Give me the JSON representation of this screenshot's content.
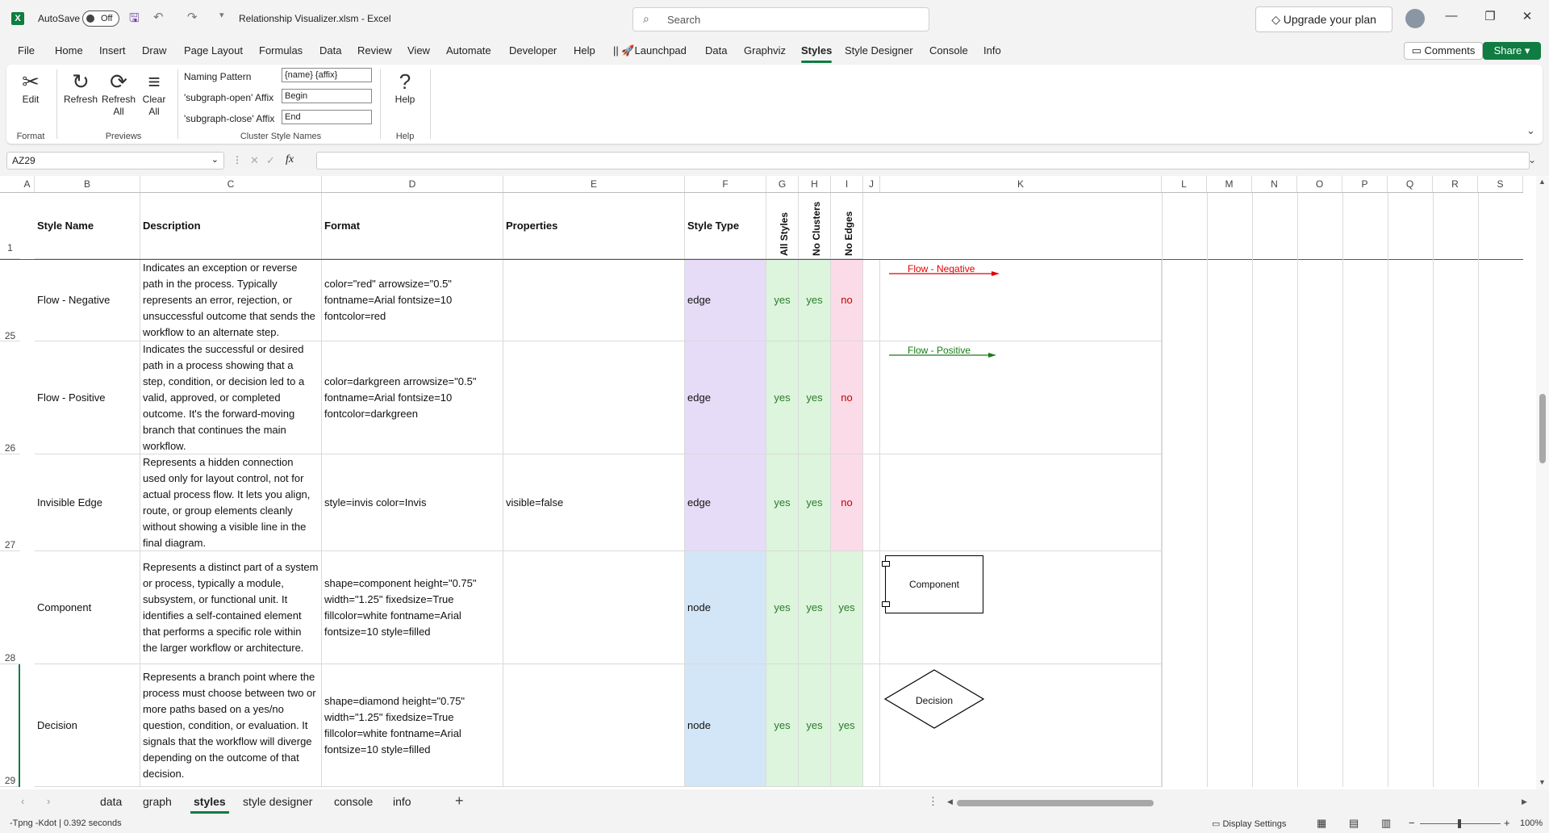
{
  "title_bar": {
    "autosave_label": "AutoSave",
    "autosave_state": "Off",
    "document_title": "Relationship Visualizer.xlsm  -  Excel",
    "search_placeholder": "Search",
    "upgrade_label": "Upgrade your plan"
  },
  "menu": {
    "items": [
      "File",
      "Home",
      "Insert",
      "Draw",
      "Page Layout",
      "Formulas",
      "Data",
      "Review",
      "View",
      "Automate",
      "Developer",
      "Help",
      "|| 🚀Launchpad",
      "Data",
      "Graphviz",
      "Styles",
      "Style Designer",
      "Console",
      "Info"
    ],
    "active": "Styles",
    "comments_label": "Comments",
    "share_label": "Share"
  },
  "ribbon": {
    "edit_label": "Edit",
    "refresh_label": "Refresh",
    "refresh_all_label1": "Refresh",
    "refresh_all_label2": "All",
    "clear_all_label1": "Clear",
    "clear_all_label2": "All",
    "help_label": "Help",
    "naming_pattern_label": "Naming Pattern",
    "naming_pattern_value": "{name} {affix}",
    "subgraph_open_label": "'subgraph-open' Affix",
    "subgraph_open_value": "Begin",
    "subgraph_close_label": "'subgraph-close' Affix",
    "subgraph_close_value": "End",
    "groups": {
      "format": "Format",
      "previews": "Previews",
      "cluster": "Cluster Style Names",
      "help": "Help"
    }
  },
  "formula_bar": {
    "name_box": "AZ29",
    "fx": "fx"
  },
  "columns": [
    "A",
    "B",
    "C",
    "D",
    "E",
    "F",
    "G",
    "H",
    "I",
    "J",
    "K",
    "L",
    "M",
    "N",
    "O",
    "P",
    "Q",
    "R",
    "S"
  ],
  "headers": {
    "style_name": "Style Name",
    "description": "Description",
    "format": "Format",
    "properties": "Properties",
    "style_type": "Style Type",
    "all_styles": "All Styles",
    "no_clusters": "No Clusters",
    "no_edges": "No Edges"
  },
  "rows": [
    {
      "num": "25",
      "name": "Flow - Negative",
      "description": "Indicates an exception or reverse path in the process. Typically represents an error, rejection, or unsuccessful outcome that sends the workflow to an alternate step.",
      "format": "color=\"red\" arrowsize=\"0.5\" fontname=Arial fontsize=10 fontcolor=red",
      "properties": "",
      "type": "edge",
      "all": "yes",
      "noclusters": "yes",
      "noedges": "no"
    },
    {
      "num": "26",
      "name": "Flow - Positive",
      "description": "Indicates the successful or desired path in a process showing that a step, condition, or decision led to a valid, approved, or completed outcome. It's the forward-moving branch that continues the main workflow.",
      "format": "color=darkgreen arrowsize=\"0.5\" fontname=Arial fontsize=10 fontcolor=darkgreen",
      "properties": "",
      "type": "edge",
      "all": "yes",
      "noclusters": "yes",
      "noedges": "no"
    },
    {
      "num": "27",
      "name": "Invisible Edge",
      "description": "Represents a hidden connection used only for layout control, not for actual process flow. It lets you align, route, or group elements cleanly without showing a visible line in the final diagram.",
      "format": "style=invis color=Invis",
      "properties": "visible=false",
      "type": "edge",
      "all": "yes",
      "noclusters": "yes",
      "noedges": "no"
    },
    {
      "num": "28",
      "name": "Component",
      "description": "Represents a distinct part of a system or process, typically a module, subsystem, or functional unit. It identifies a self-contained element that performs a specific role within the larger workflow or architecture.",
      "format": "shape=component height=\"0.75\" width=\"1.25\" fixedsize=True fillcolor=white fontname=Arial fontsize=10 style=filled",
      "properties": "",
      "type": "node",
      "all": "yes",
      "noclusters": "yes",
      "noedges": "yes"
    },
    {
      "num": "29",
      "name": "Decision",
      "description": "Represents a branch point where the process must choose between two or more paths based on a yes/no question, condition, or evaluation. It signals that the workflow will diverge depending on the outcome of that decision.",
      "format": "shape=diamond height=\"0.75\" width=\"1.25\" fixedsize=True fillcolor=white fontname=Arial fontsize=10 style=filled",
      "properties": "",
      "type": "node",
      "all": "yes",
      "noclusters": "yes",
      "noedges": "yes"
    }
  ],
  "header_row_num": "1",
  "previews": {
    "flow_negative": "Flow - Negative",
    "flow_positive": "Flow - Positive",
    "component": "Component",
    "decision": "Decision"
  },
  "sheet_tabs": [
    "data",
    "graph",
    "styles",
    "style designer",
    "console",
    "info"
  ],
  "active_sheet": "styles",
  "status": {
    "left": "-Tpng -Kdot | 0.392 seconds",
    "display_settings": "Display Settings",
    "zoom": "100%"
  },
  "colors": {
    "excel_green": "#107c41",
    "edge_type_fill": "#e6dcf7",
    "node_type_fill": "#d3e6f8",
    "yes_fill": "#dcf5dc",
    "no_fill": "#fbdbe7",
    "negative": "#e00000",
    "positive": "#1a7a1a"
  }
}
